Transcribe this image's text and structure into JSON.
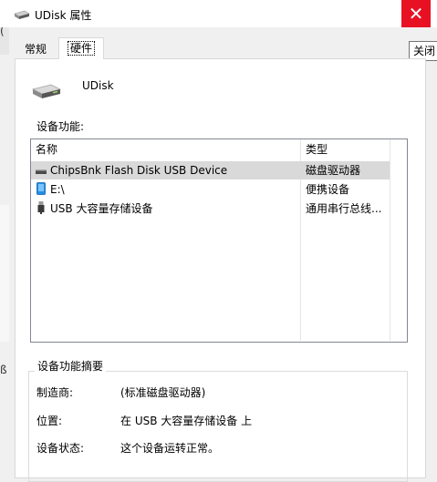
{
  "window": {
    "title": "UDisk 属性",
    "close_glyph": "✕",
    "close_tooltip": "关闭"
  },
  "background_window": {
    "fragment_top": "(",
    "fragment_bottom": "ß"
  },
  "tabs": [
    {
      "label": "常规",
      "selected": false
    },
    {
      "label": "硬件",
      "selected": true
    }
  ],
  "device": {
    "name": "UDisk",
    "icon": "drive-icon"
  },
  "device_functions": {
    "label": "设备功能:",
    "columns": [
      "名称",
      "类型"
    ],
    "rows": [
      {
        "icon": "disk-drive-icon",
        "name": "ChipsBnk Flash Disk USB Device",
        "type": "磁盘驱动器",
        "selected": true
      },
      {
        "icon": "portable-device-icon",
        "name": "E:\\",
        "type": "便携设备",
        "selected": false
      },
      {
        "icon": "usb-icon",
        "name": "USB 大容量存储设备",
        "type": "通用串行总线...",
        "selected": false
      }
    ]
  },
  "summary": {
    "title": "设备功能摘要",
    "properties": [
      {
        "label": "制造商:",
        "value": "(标准磁盘驱动器)"
      },
      {
        "label": "位置:",
        "value": "在 USB 大容量存储设备 上"
      },
      {
        "label": "设备状态:",
        "value": "这个设备运转正常。"
      }
    ]
  },
  "colors": {
    "close_red": "#e81123",
    "selection_gray": "#d9d9d9",
    "portable_blue": "#1e90e8"
  }
}
